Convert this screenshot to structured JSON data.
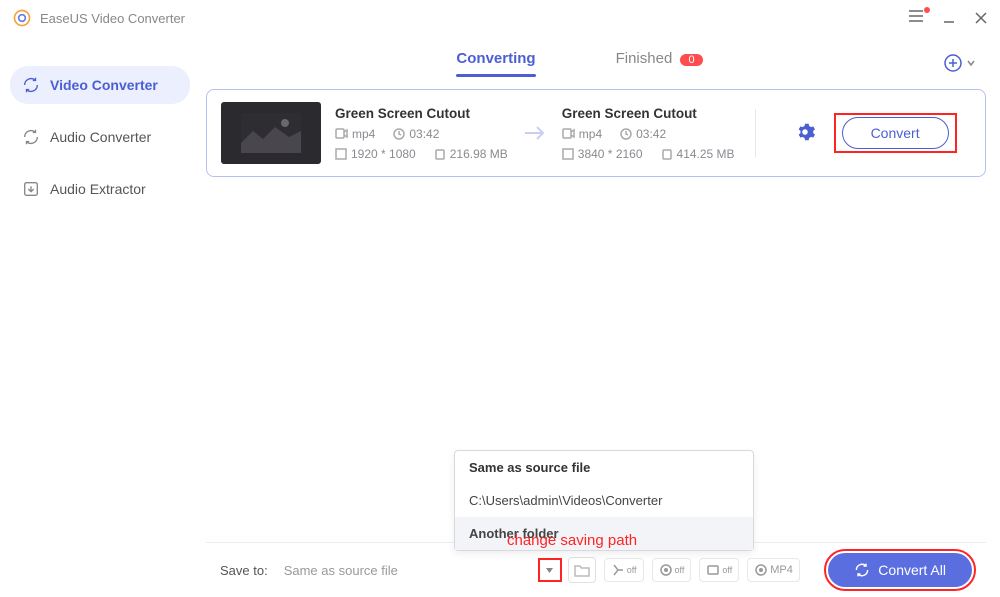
{
  "app": {
    "title": "EaseUS Video Converter"
  },
  "sidebar": {
    "items": [
      {
        "label": "Video Converter",
        "active": true
      },
      {
        "label": "Audio Converter",
        "active": false
      },
      {
        "label": "Audio Extractor",
        "active": false
      }
    ]
  },
  "tabs": {
    "converting": "Converting",
    "finished": "Finished",
    "finished_count": "0"
  },
  "task": {
    "source": {
      "title": "Green Screen Cutout",
      "format": "mp4",
      "duration": "03:42",
      "resolution": "1920 * 1080",
      "size": "216.98 MB"
    },
    "target": {
      "title": "Green Screen Cutout",
      "format": "mp4",
      "duration": "03:42",
      "resolution": "3840 * 2160",
      "size": "414.25 MB"
    },
    "convert_label": "Convert"
  },
  "save_dropdown": {
    "opt1": "Same as source file",
    "opt2": "C:\\Users\\admin\\Videos\\Converter",
    "opt3": "Another folder"
  },
  "bottom": {
    "save_to": "Save to:",
    "save_value": "Same as source file",
    "merge": "off",
    "hw": "off",
    "hs": "off",
    "fmt": "MP4",
    "convert_all": "Convert All"
  },
  "annotation": "change saving path"
}
